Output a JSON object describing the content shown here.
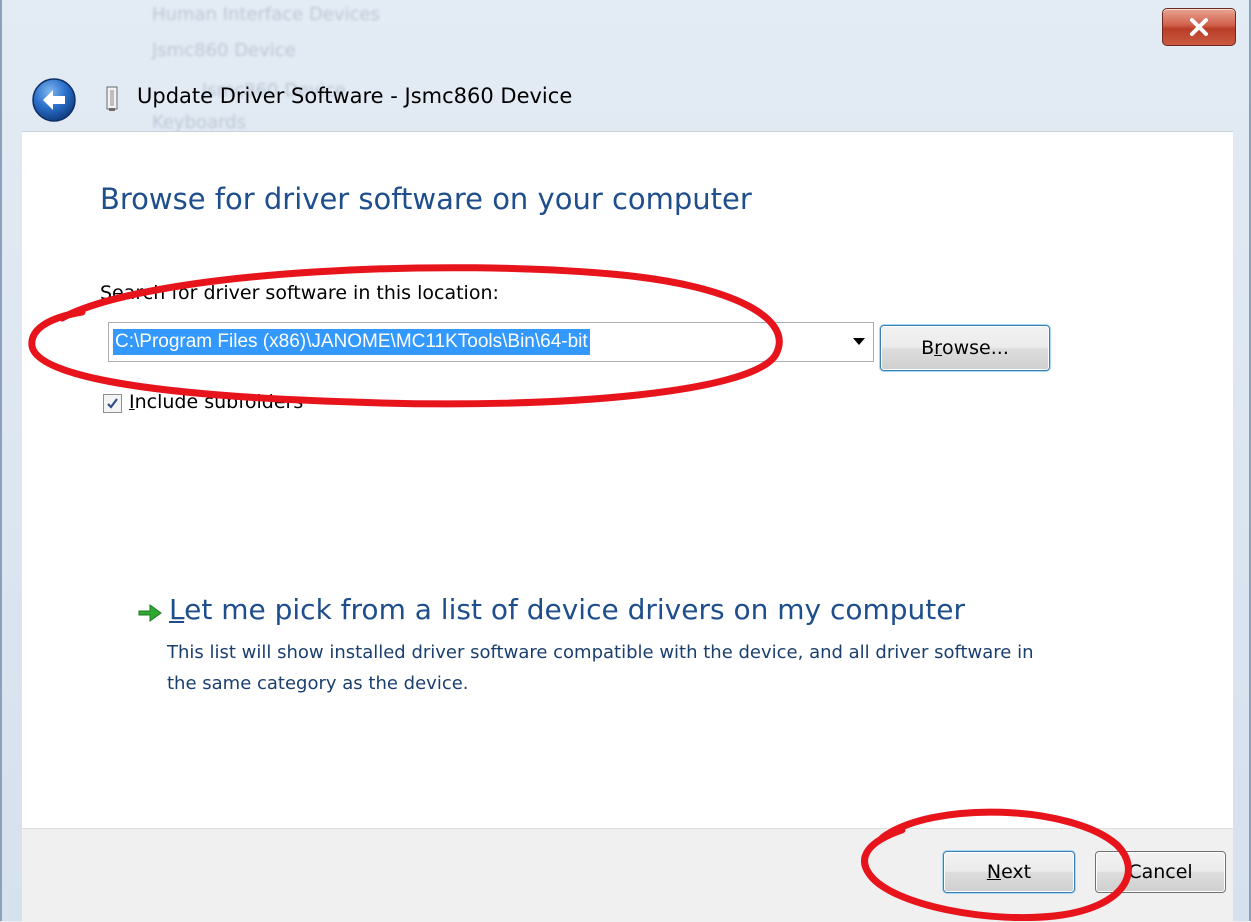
{
  "window": {
    "title": "Update Driver Software - Jsmc860 Device",
    "back_icon": "back-arrow-icon",
    "close_icon": "close-icon"
  },
  "background_ghosts": [
    "Human Interface Devices",
    "Jsmc860 Device",
    "Jsmc860 Device",
    "Keyboards"
  ],
  "main": {
    "heading": "Browse for driver software on your computer",
    "search_label": "Search for driver software in this location:",
    "path_value": "C:\\Program Files (x86)\\JANOME\\MC11KTools\\Bin\\64-bit",
    "browse_label_pre": "B",
    "browse_label_accel": "r",
    "browse_label_post": "owse...",
    "include_subfolders_accel": "I",
    "include_subfolders_rest": "nclude subfolders",
    "include_subfolders_checked": true,
    "option_title_accel": "L",
    "option_title_rest": "et me pick from a list of device drivers on my computer",
    "option_desc": "This list will show installed driver software compatible with the device, and all driver software in the same category as the device."
  },
  "footer": {
    "next_accel": "N",
    "next_rest": "ext",
    "cancel_label": "Cancel"
  },
  "colors": {
    "heading": "#1e4e8c",
    "selection": "#3399ff",
    "annotation": "#e8141c",
    "arrow_green": "#2fa832"
  }
}
